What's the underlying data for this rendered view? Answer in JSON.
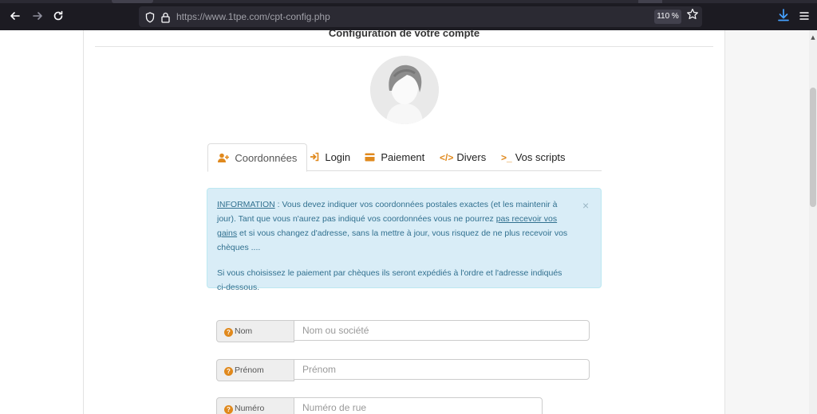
{
  "browser": {
    "url_host": "https://www.1tpe.com",
    "url_path": "/cpt-config.php",
    "zoom": "110 %",
    "icons": {
      "back": "arrow-left-icon",
      "forward": "arrow-right-icon",
      "reload": "reload-icon",
      "shield": "shield-icon",
      "lock": "lock-icon",
      "bookmark": "star-icon",
      "download": "download-icon",
      "menu": "hamburger-menu-icon"
    }
  },
  "page": {
    "heading": "Configuration de votre compte"
  },
  "tabs": [
    {
      "label": "Coordonnées",
      "icon": "user-plus-icon",
      "active": true
    },
    {
      "label": "Login",
      "icon": "sign-in-icon",
      "active": false
    },
    {
      "label": "Paiement",
      "icon": "credit-card-icon",
      "active": false
    },
    {
      "label": "Divers",
      "icon": "code-icon",
      "active": false
    },
    {
      "label": "Vos scripts",
      "icon": "terminal-icon",
      "active": false
    }
  ],
  "alert": {
    "info_label": "INFORMATION",
    "text1": " : Vous devez indiquer vos coordonnées postales exactes (et les maintenir à jour). Tant que vous n'aurez pas indiqué vos coordonnées vous ne pourrez ",
    "link_text": "pas recevoir vos gains",
    "text2": " et si vous changez d'adresse, sans la mettre à jour, vous risquez de ne plus recevoir vos chèques ....",
    "paragraph2": "Si vous choisissez le paiement par chèques ils seront expédiés à l'ordre et l'adresse indiqués ci-dessous.",
    "close": "×",
    "color_bg": "#d9edf7",
    "color_text": "#31708f"
  },
  "form": {
    "fields": [
      {
        "label": "Nom",
        "placeholder": "Nom ou société",
        "help_icon": "question-circle-icon"
      },
      {
        "label": "Prénom",
        "placeholder": "Prénom",
        "help_icon": "question-circle-icon"
      },
      {
        "label": "Numéro",
        "placeholder": "Numéro de rue",
        "help_icon": "question-circle-icon"
      }
    ]
  },
  "colors": {
    "accent": "#e0891d",
    "chrome_bg": "#1c1b22",
    "download_blue": "#45a1ff"
  }
}
